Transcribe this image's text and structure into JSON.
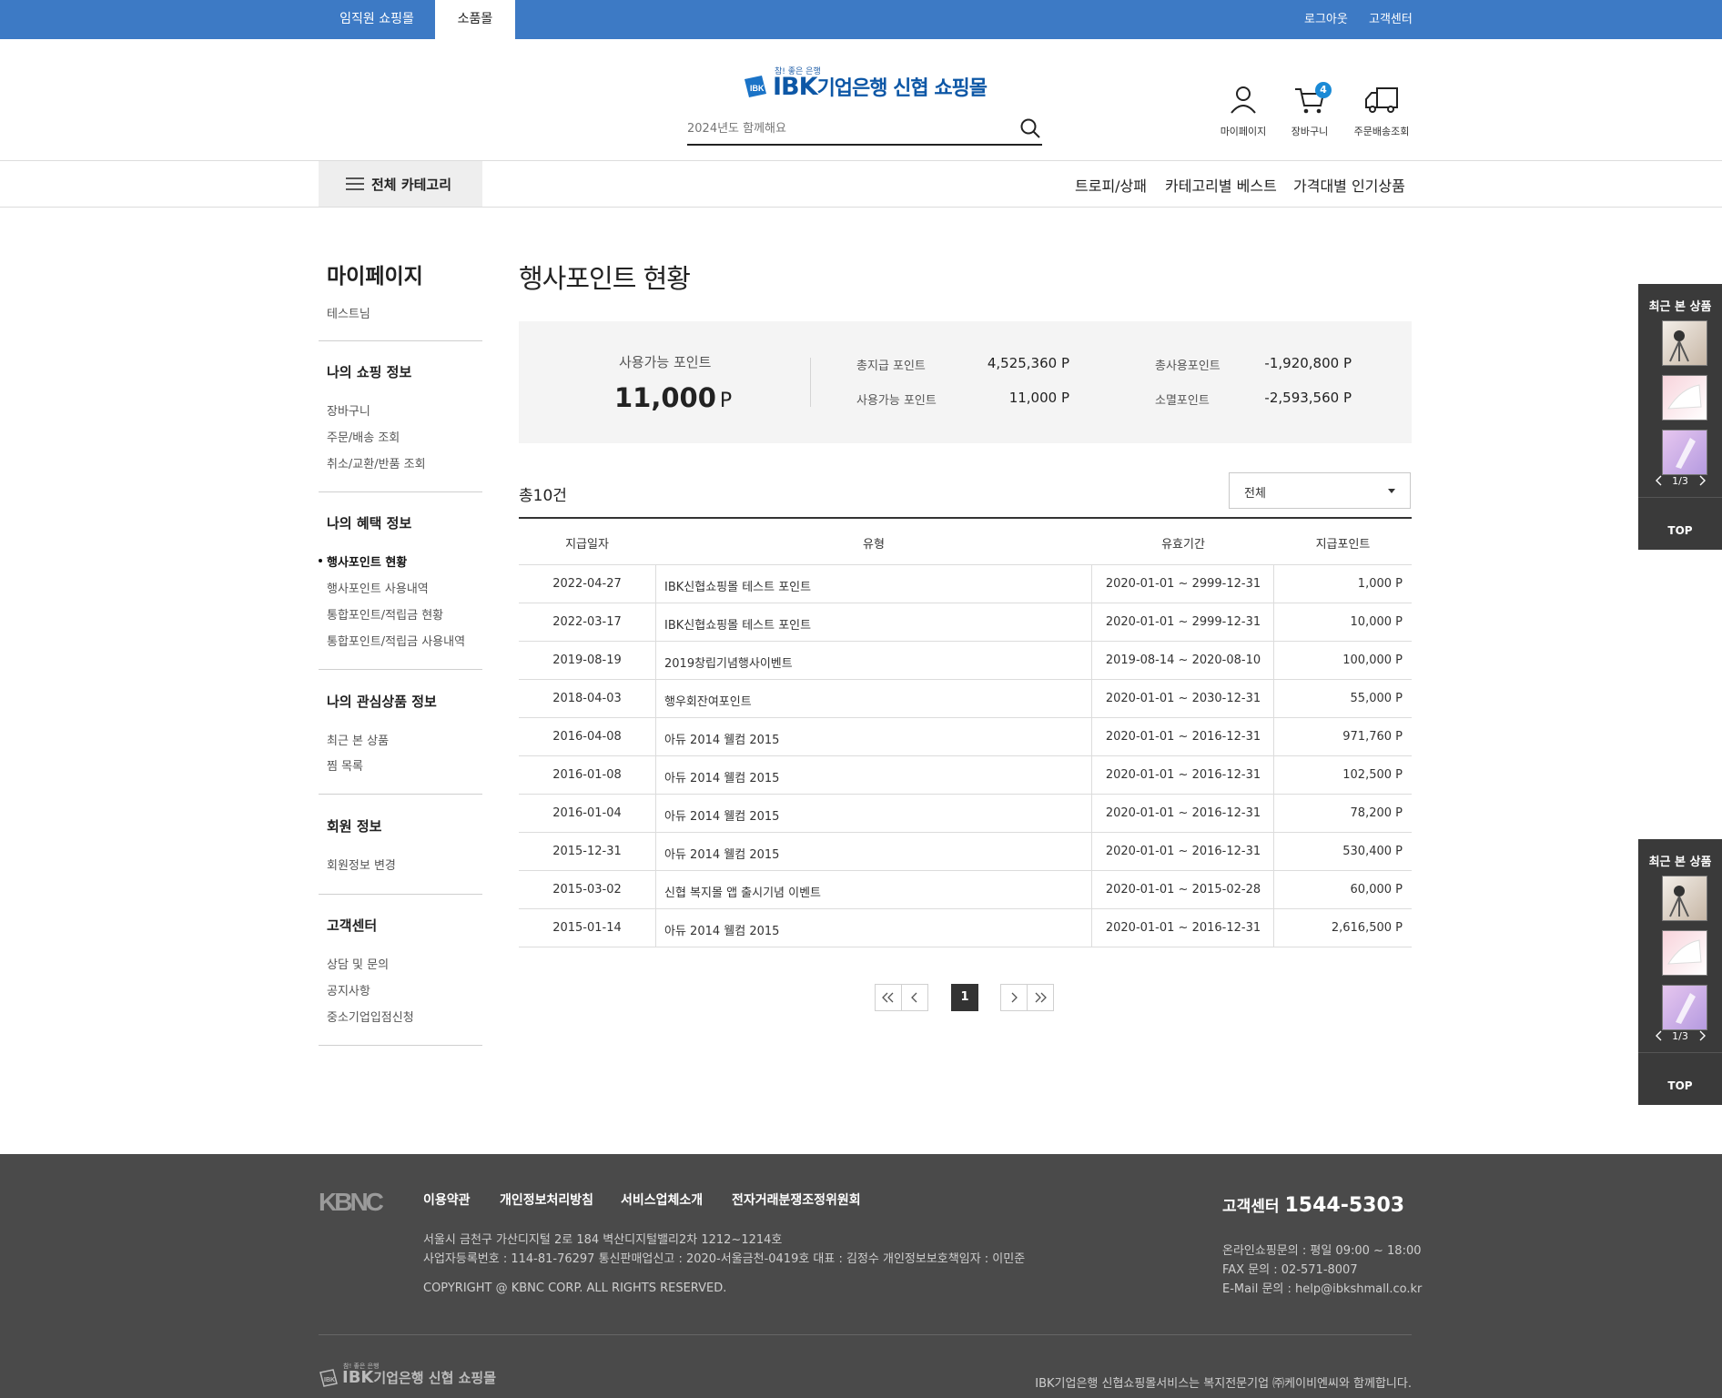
{
  "top_bar": {
    "tabs": [
      "임직원 쇼핑몰",
      "소품몰"
    ],
    "links": [
      "로그아웃",
      "고객센터"
    ]
  },
  "header": {
    "logo_sub": "참! 좋은 은행",
    "logo_brand": "IBK",
    "logo_text": "기업은행 신협 쇼핑몰",
    "search_placeholder": "2024년도 함께해요",
    "icons": {
      "mypage": "마이페이지",
      "cart": "장바구니",
      "cart_count": "4",
      "delivery": "주문배송조회"
    }
  },
  "nav": {
    "all_category": "전체 카테고리",
    "menu": [
      "트로피/상패",
      "카테고리별 베스트",
      "가격대별 인기상품"
    ]
  },
  "sidebar": {
    "title": "마이페이지",
    "user": "테스트님",
    "sections": [
      {
        "heading": "나의 쇼핑 정보",
        "items": [
          "장바구니",
          "주문/배송 조회",
          "취소/교환/반품 조회"
        ]
      },
      {
        "heading": "나의 혜택 정보",
        "items": [
          "행사포인트 현황",
          "행사포인트 사용내역",
          "통합포인트/적립금 현황",
          "통합포인트/적립금 사용내역"
        ]
      },
      {
        "heading": "나의 관심상품 정보",
        "items": [
          "최근 본 상품",
          "찜 목록"
        ]
      },
      {
        "heading": "회원 정보",
        "items": [
          "회원정보 변경"
        ]
      },
      {
        "heading": "고객센터",
        "items": [
          "상담 및 문의",
          "공지사항",
          "중소기업입점신청"
        ]
      }
    ]
  },
  "main": {
    "title": "행사포인트 현황",
    "summary": {
      "available_label": "사용가능 포인트",
      "available_value": "11,000",
      "unit": "P",
      "stats": [
        {
          "label": "총지급 포인트",
          "value": "4,525,360 P"
        },
        {
          "label": "사용가능 포인트",
          "value": "11,000 P"
        },
        {
          "label": "총사용포인트",
          "value": "-1,920,800 P"
        },
        {
          "label": "소멸포인트",
          "value": "-2,593,560 P"
        }
      ]
    },
    "count": "총10건",
    "filter": "전체",
    "table": {
      "headers": [
        "지급일자",
        "유형",
        "유효기간",
        "지급포인트"
      ],
      "rows": [
        [
          "2022-04-27",
          "IBK신협쇼핑몰 테스트 포인트",
          "2020-01-01 ~ 2999-12-31",
          "1,000 P"
        ],
        [
          "2022-03-17",
          "IBK신협쇼핑몰 테스트 포인트",
          "2020-01-01 ~ 2999-12-31",
          "10,000 P"
        ],
        [
          "2019-08-19",
          "2019창립기념행사이벤트",
          "2019-08-14 ~ 2020-08-10",
          "100,000 P"
        ],
        [
          "2018-04-03",
          "행우회잔여포인트",
          "2020-01-01 ~ 2030-12-31",
          "55,000 P"
        ],
        [
          "2016-04-08",
          "아듀 2014 웰컴 2015",
          "2020-01-01 ~ 2016-12-31",
          "971,760 P"
        ],
        [
          "2016-01-08",
          "아듀 2014 웰컴 2015",
          "2020-01-01 ~ 2016-12-31",
          "102,500 P"
        ],
        [
          "2016-01-04",
          "아듀 2014 웰컴 2015",
          "2020-01-01 ~ 2016-12-31",
          "78,200 P"
        ],
        [
          "2015-12-31",
          "아듀 2014 웰컴 2015",
          "2020-01-01 ~ 2016-12-31",
          "530,400 P"
        ],
        [
          "2015-03-02",
          "신협 복지몰 앱 출시기념 이벤트",
          "2020-01-01 ~ 2015-02-28",
          "60,000 P"
        ],
        [
          "2015-01-14",
          "아듀 2014 웰컴 2015",
          "2020-01-01 ~ 2016-12-31",
          "2,616,500 P"
        ]
      ]
    },
    "pagination": {
      "current": "1"
    }
  },
  "quick_panel": {
    "title": "최근 본 상품",
    "page": "1/3",
    "top": "TOP"
  },
  "footer": {
    "logo": "KBNC",
    "links": [
      "이용약관",
      "개인정보처리방침",
      "서비스업체소개",
      "전자거래분쟁조정위원회"
    ],
    "address": "서울시 금천구 가산디지털 2로 184 벽산디지털밸리2차 1212~1214호",
    "business": "사업자등록번호 : 114-81-76297 통신판매업신고 : 2020-서울금천-0419호 대표 : 김정수 개인정보보호책임자 : 이민준",
    "copyright": "COPYRIGHT @ KBNC CORP. ALL RIGHTS RESERVED.",
    "cs_label": "고객센터",
    "cs_number": "1544-5303",
    "cs_lines": [
      "온라인쇼핑문의 : 평일 09:00 ~ 18:00",
      "FAX 문의 : 02-571-8007",
      "E-Mail 문의 : help@ibkshmall.co.kr"
    ],
    "bottom_logo_sub": "참! 좋은 은행",
    "bottom_logo_brand": "IBK",
    "bottom_logo_text": "기업은행 신협 쇼핑몰",
    "service_note": "IBK기업은행 신협쇼핑몰서비스는 복지전문기업 ㈜케이비엔씨와 함께합니다."
  },
  "colors": {
    "top_bar": "#3d7ac5",
    "brand_blue": "#0d57a6",
    "badge": "#1a8ad6",
    "footer_bg": "#4a4a4a",
    "quick_bg": "#3a3a3a"
  }
}
